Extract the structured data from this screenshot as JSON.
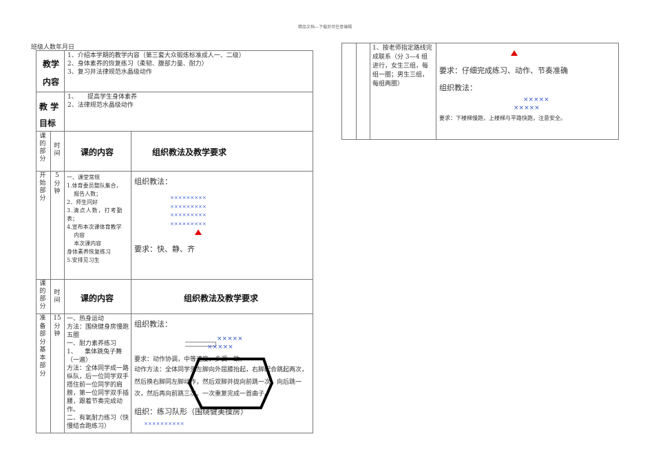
{
  "watermark": "精品文档---下载后可任意编辑",
  "class_line": "班级人数年月日",
  "teaching_content": {
    "label_1": "教学",
    "label_2": "内容",
    "items": [
      "1、介绍本学期的教学内容（第三套大众锻炼标准成人一、二级）",
      "2、身体素养的恢复练习（柔韧、腹部力量、耐力）",
      "3、复习并法律规范水晶级动作"
    ]
  },
  "teaching_goal": {
    "label_1": "教 学",
    "label_2": "目标",
    "items": [
      "1、     提高学生身体素养",
      "2、法律规范水晶级动作"
    ]
  },
  "header": {
    "part": "课的部分",
    "time": "时间",
    "content": "课的内容",
    "method": "组织教法及教学要求"
  },
  "start_section": {
    "part": "开始部分",
    "time_1": "5",
    "time_2": "分钟",
    "content": [
      "一、课堂常规",
      "1.体育委员整队集合，",
      "    报告人数；",
      "2．师生问好",
      "3.清点人数，打考勤",
      "表；",
      "4.宣布本次课体育教学",
      "    内容",
      "    本次课内容",
      "身体素养恢复练习",
      "5.安排见习生"
    ],
    "method_title": "组织教法：",
    "formation_rows": [
      "×××××××××",
      "×××××××××",
      "×××××××××",
      "×××××××××"
    ],
    "requirement": "要求：快、静、齐"
  },
  "prep_section": {
    "part": "准备部分基本部分",
    "time_1": "15",
    "time_2": "分钟",
    "content": [
      "一、热身运动",
      "方法：围绕健身房慢跑五圈",
      "一、耐力素养练习",
      "1、    集体跳兔子舞（一遍）",
      "方法：全体同学成一路纵队，后一位同学双手搭住前一位同学的肩膀，第一位同学双手插腰，跟着节奏完成动作。",
      "二、有氧耐力练习（快慢结合跑练习）"
    ],
    "method_title": "组织教法：",
    "formation_rows": [
      "×××××",
      "×××××"
    ],
    "requirement": "要求：动作协调，中等速度，步调一致。",
    "action": "动作方法：全体同学先左脚向外屈膝抬起，右脚配合跳起两次，然后换右脚同左脚动作，然后双脚并拢向前跳一次，向后跳一次，然后再向前跳三次。一次重复完成一首曲子。",
    "org": "组织：练习队形（围绕健美操房）",
    "org_row": "××××××××××"
  },
  "right_section": {
    "content": "1、按老师指定路线完成联系（分 3—4 组进行，女生三组，每组一圈；男生三组，每组两圈）",
    "requirement_1": "要求：仔细完成练习、动作、节奏准确",
    "method_title": "组织教法：",
    "formation_rows": [
      "×××××",
      "×××××"
    ],
    "requirement_2": "要求：下楼梯慢跑，上楼梯与平路快跑，注意安全。"
  },
  "colors": {
    "accent_red": "#e00000",
    "formation_blue": "#3355cc"
  }
}
